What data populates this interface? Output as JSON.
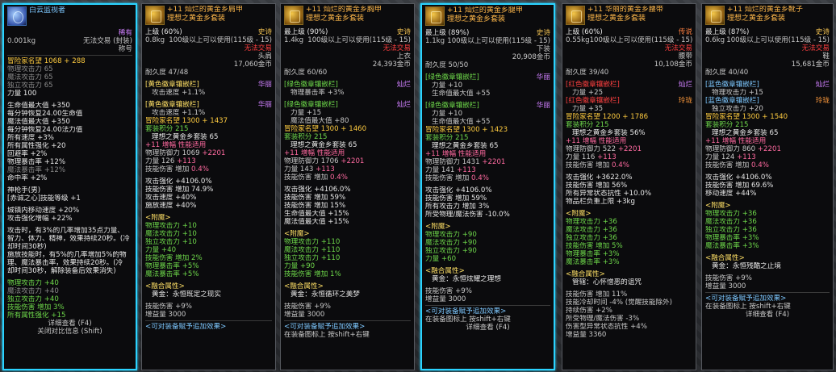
{
  "card1": {
    "title": "白云监视者",
    "grade": "稀有",
    "weight": "0.001kg",
    "trade": "无法交易 (封装)",
    "type": "称号",
    "fame": "冒险家名望 1068 + 288",
    "stats": [
      {
        "t": "物理攻击力 65",
        "c": "gray"
      },
      {
        "t": "魔法攻击力 65",
        "c": "gray"
      },
      {
        "t": "独立攻击力 65",
        "c": "gray"
      },
      {
        "t": "力量 100",
        "c": "white"
      }
    ],
    "stats2": [
      {
        "t": "生命值最大值 +350",
        "c": "white"
      },
      {
        "t": "每分钟恢复24.00生命值",
        "c": "white"
      },
      {
        "t": "魔法值最大值 +350",
        "c": "white"
      },
      {
        "t": "每分钟恢复24.00法力值",
        "c": "white"
      },
      {
        "t": "所有速度 +3%",
        "c": "white"
      },
      {
        "t": "所有属性强化 +20",
        "c": "white"
      },
      {
        "t": "回避率 +2%",
        "c": "white"
      },
      {
        "t": "物理暴击率 +12%",
        "c": "white"
      },
      {
        "t": "魔法暴击率 +12%",
        "c": "gray"
      },
      {
        "t": "命中率 +2%",
        "c": "white"
      }
    ],
    "skill_title": "神枪手(男)",
    "skill_line": "[赤诚之心]技能等级 +1",
    "skill_effects": [
      "城镇内移动速度 +20%",
      "攻击强化增幅 +22%"
    ],
    "desc": [
      "攻击时，有3%的几率增加35点力量、",
      "智力、体力、精神，效果持续20秒。(冷",
      "却时间30秒)",
      "施放技能时，有5%的几率增加5%的物",
      "理、魔法暴击率，效果持续20秒。(冷",
      "却时间30秒，解除装备后效果消失)"
    ],
    "ench": [
      {
        "t": "物理攻击力 +40",
        "c": "green"
      },
      {
        "t": "魔法攻击力 +40",
        "c": "gray"
      },
      {
        "t": "独立攻击力 +40",
        "c": "green"
      },
      {
        "t": "技能伤害 增加 3%",
        "c": "green"
      },
      {
        "t": "所有属性强化 +15",
        "c": "green"
      }
    ],
    "foot1": "详细查看 (F4)",
    "foot2": "关闭对比信息 (Shift)"
  },
  "card2": {
    "name": "+11 灿烂的黄金乡肩甲",
    "set": "理想之黄金乡套装",
    "grade": "上级 (60%)",
    "rarity": "史诗",
    "weight": "0.8kg",
    "req": "100级以上可以使用(115级 - 15)",
    "trade": "无法交易",
    "slot": "头肩",
    "price": "17,060金币",
    "dura": "耐久度 47/48",
    "emblem1_l": "[黄色徽章镶嵌栏]",
    "emblem1_r": "华丽",
    "emblem1_v": "攻击速度 +1.1%",
    "emblem2_l": "[黄色徽章镶嵌栏]",
    "emblem2_r": "华丽",
    "emblem2_v": "攻击速度 +1.1%",
    "fame": "冒险家名望 1300 + 1437",
    "setpt": "套装积分 215",
    "setname": "理想之黄金乡套装 65",
    "amp": "+11 增幅 性能适用",
    "pdef": "物理防御力 1069",
    "pdef_b": "+2201",
    "str": "力量 126",
    "str_b": "+113",
    "skill": "技能伤害 增加",
    "skill_b": "0.4%",
    "opts": [
      "攻击强化 +4106.0%",
      "技能伤害 增加 74.9%",
      "攻击速度 +40%",
      "施放速度 +40%"
    ],
    "ench_title": "<附魔>",
    "ench": [
      "物理攻击力 +10",
      "魔法攻击力 +10",
      "独立攻击力 +10",
      "力量 +40",
      "技能伤害 增加 2%",
      "物理暴击率 +5%",
      "魔法暴击率 +5%"
    ],
    "fuse_title": "<融合属性>",
    "fuse": "黄金：永恒既定之现实",
    "f1": "技能伤害 +9%",
    "f2": "增益量 3000",
    "tip": "<可对装备赋予追加效果>"
  },
  "card3": {
    "name": "+11 灿烂的黄金乡胸甲",
    "set": "理想之黄金乡套装",
    "grade": "最上级 (90%)",
    "rarity": "史诗",
    "weight": "1.4kg",
    "req": "100级以上可以使用(115级 - 15)",
    "trade": "无法交易",
    "slot": "上衣",
    "price": "24,393金币",
    "dura": "耐久度 60/60",
    "e1l": "[绿色徽章镶嵌栏]",
    "e1r": "灿烂",
    "e1a": "物理暴击率 +3%",
    "e2l": "[绿色徽章镶嵌栏]",
    "e2r": "灿烂",
    "e2a": "力量 +15",
    "e2b": "魔法值最大值 +80",
    "fame": "冒险家名望 1300 + 1460",
    "setpt": "套装积分 215",
    "setname": "理想之黄金乡套装 65",
    "amp": "+11 增幅 性能适用",
    "pdef": "物理防御力 1706",
    "pdef_b": "+2201",
    "str": "力量 143",
    "str_b": "+113",
    "skill": "技能伤害 增加",
    "skill_b": "0.4%",
    "opts": [
      "攻击强化 +4106.0%",
      "技能伤害 增加 59%",
      "技能伤害 增加 15%",
      "生命值最大值 +15%",
      "魔法值最大值 +15%"
    ],
    "ench_title": "<附魔>",
    "ench": [
      "物理攻击力 +110",
      "魔法攻击力 +110",
      "独立攻击力 +110",
      "力量 +90",
      "技能伤害 增加 1%"
    ],
    "fuse_title": "<融合属性>",
    "fuse": "黄金：永恒循环之美梦",
    "f1": "技能伤害 +9%",
    "f2": "增益量 3000",
    "tip": "<可对装备赋予追加效果>",
    "tip2": "在装备图标上 按shift+右键"
  },
  "card4": {
    "name": "+11 灿烂的黄金乡腿甲",
    "set": "理想之黄金乡套装",
    "grade": "最上级 (89%)",
    "rarity": "史诗",
    "weight": "1.1kg",
    "req": "100级以上可以使用(115级 - 15)",
    "slot": "下装",
    "price": "20,908金币",
    "dura": "耐久度 50/50",
    "e1l": "[绿色徽章镶嵌栏]",
    "e1r": "华丽",
    "e1a": "力量 +10",
    "e1b": "生命值最大值 +55",
    "e2l": "[绿色徽章镶嵌栏]",
    "e2r": "华丽",
    "e2a": "力量 +10",
    "e2b": "生命值最大值 +55",
    "fame": "冒险家名望 1300 + 1423",
    "setpt": "套装积分 215",
    "setname": "理想之黄金乡套装 65",
    "amp": "+11 增幅 性能适用",
    "pdef": "物理防御力 1431",
    "pdef_b": "+2201",
    "str": "力量 141",
    "str_b": "+113",
    "skill": "技能伤害 增加",
    "skill_b": "0.4%",
    "opts": [
      "攻击强化 +4106.0%",
      "技能伤害 增加 59%",
      "所有攻击力 增加 3%",
      "所受物理/魔法伤害 -10.0%"
    ],
    "ench_title": "<附魔>",
    "ench": [
      "物理攻击力 +90",
      "魔法攻击力 +90",
      "独立攻击力 +90",
      "力量 +60"
    ],
    "fuse_title": "<融合属性>",
    "fuse": "黄金：永恒炫耀之理想",
    "f1": "技能伤害 +9%",
    "f2": "增益量 3000",
    "tip": "<可对装备赋予追加效果>",
    "tip2": "在装备图标上 按shift+右键",
    "foot": "详细查看 (F4)"
  },
  "card5": {
    "name": "+11 华丽的黄金乡腰带",
    "set": "理想之黄金乡套装",
    "grade": "上级 (60%)",
    "rarity": "传说",
    "weight": "0.55kg",
    "req": "100级以上可以使用(115级 - 15)",
    "trade": "无法交易",
    "slot": "腰带",
    "price": "10,108金币",
    "dura": "耐久度 39/40",
    "e1l": "[红色徽章镶嵌栏]",
    "e1r": "灿烂",
    "e1a": "力量 +25",
    "e2l": "[红色徽章镶嵌栏]",
    "e2r": "玲珑",
    "e2a": "力量 +35",
    "fame": "冒险家名望 1200 + 1786",
    "setpt": "套装积分 215",
    "setname": "理想之黄金乡套装 56%",
    "amp": "+11 增幅 性能适用",
    "pdef": "物理防御力 522",
    "pdef_b": "+2201",
    "str": "力量 116",
    "str_b": "+113",
    "skill": "技能伤害 增加",
    "skill_b": "0.4%",
    "opts": [
      "攻击强化 +3622.0%",
      "技能伤害 增加 56%",
      "所有异常状态抗性 +10.0%",
      "物品栏负重上限 +3kg"
    ],
    "ench_title": "<附魔>",
    "ench": [
      "物理攻击力 +36",
      "魔法攻击力 +36",
      "独立攻击力 +36",
      "技能伤害 增加 5%",
      "物理暴击率 +3%",
      "魔法暴击率 +3%"
    ],
    "fuse_title": "<融合属性>",
    "fuse": "管辖：心怀憎恶的诅咒",
    "fx": [
      "技能伤害 增加 11%",
      "技能冷却时间 -4% (觉醒技能除外)",
      "持续伤害 +2%",
      "所受物理/魔法伤害 -3%",
      "伤害型异常状态抗性 +4%",
      "增益量 3360"
    ]
  },
  "card6": {
    "name": "+11 灿烂的黄金乡靴子",
    "set": "理想之黄金乡套装",
    "grade": "最上级 (87%)",
    "rarity": "史诗",
    "weight": "0.6kg",
    "req": "100级以上可以使用(115级 - 15)",
    "trade": "无法交易",
    "slot": "鞋",
    "price": "15,681金币",
    "dura": "耐久度 40/40",
    "e1l": "[蓝色徽章镶嵌栏]",
    "e1r": "灿烂",
    "e1a": "物理攻击力 +15",
    "e2l": "[蓝色徽章镶嵌栏]",
    "e2r": "玲珑",
    "e2a": "独立攻击力 +20",
    "fame": "冒险家名望 1300 + 1540",
    "setpt": "套装积分 215",
    "setname": "理想之黄金乡套装 65",
    "amp": "+11 增幅 性能适用",
    "pdef": "物理防御力 860",
    "pdef_b": "+2201",
    "str": "力量 124",
    "str_b": "+113",
    "skill": "技能伤害 增加",
    "skill_b": "0.4%",
    "opts": [
      "攻击强化 +4106.0%",
      "技能伤害 增加 69.6%",
      "移动速度 +44%"
    ],
    "ench_title": "<附魔>",
    "ench": [
      "物理攻击力 +36",
      "魔法攻击力 +36",
      "独立攻击力 +36",
      "物理暴击率 +3%",
      "魔法暴击率 +3%"
    ],
    "fuse_title": "<融合属性>",
    "fuse": "黄金：永恒残酷之止境",
    "f1": "技能伤害 +9%",
    "f2": "增益量 3000",
    "tip": "<可对装备赋予追加效果>",
    "tip2": "在装备图标上 按shift+右键",
    "foot": "详细查看 (F4)"
  }
}
